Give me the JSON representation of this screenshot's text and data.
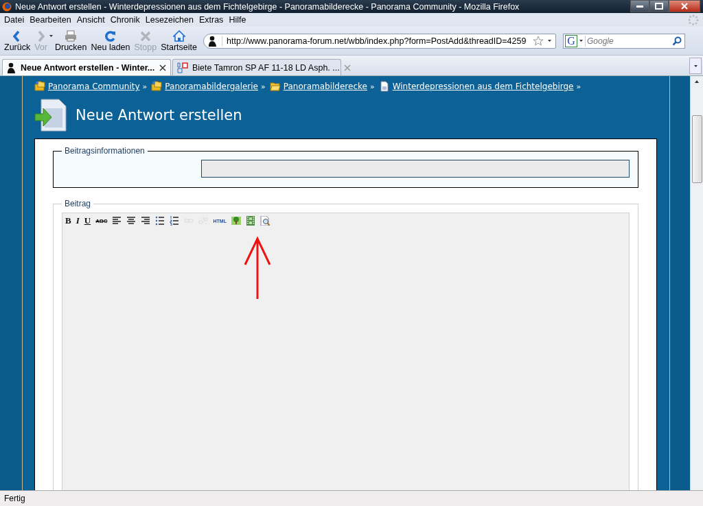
{
  "window": {
    "title": "Neue Antwort erstellen - Winterdepressionen aus dem Fichtelgebirge - Panoramabilderecke - Panorama Community - Mozilla Firefox"
  },
  "menu": [
    "Datei",
    "Bearbeiten",
    "Ansicht",
    "Chronik",
    "Lesezeichen",
    "Extras",
    "Hilfe"
  ],
  "nav_buttons": [
    {
      "kind": "back",
      "label": "Zurück",
      "disabled": false
    },
    {
      "kind": "forward",
      "label": "Vor",
      "disabled": true
    },
    {
      "kind": "print",
      "label": "Drucken",
      "disabled": false
    },
    {
      "kind": "reload",
      "label": "Neu laden",
      "disabled": false
    },
    {
      "kind": "stop",
      "label": "Stopp",
      "disabled": true
    },
    {
      "kind": "home",
      "label": "Startseite",
      "disabled": false
    }
  ],
  "address": {
    "value": "http://www.panorama-forum.net/wbb/index.php?form=PostAdd&threadID=4259"
  },
  "search": {
    "engine": "G",
    "placeholder": "Google"
  },
  "tabs": [
    {
      "label": "Neue Antwort erstellen - Winter...",
      "selected": true,
      "kind": "forum"
    },
    {
      "label": "Biete Tamron SP AF 11-18 LD Asph. ...",
      "selected": false,
      "kind": "dslr"
    }
  ],
  "breadcrumb": [
    {
      "label": "Panorama Community",
      "kind": "folders",
      "after": "»"
    },
    {
      "label": "Panoramabildergalerie",
      "kind": "folders",
      "after": "»"
    },
    {
      "label": "Panoramabilderecke",
      "kind": "folder",
      "after": "»"
    },
    {
      "label": "Winterdepressionen aus dem Fichtelgebirge",
      "kind": "page",
      "after": "»"
    }
  ],
  "heading": "Neue Antwort erstellen",
  "sections": [
    {
      "legend": "Beitragsinformationen",
      "kind": "info"
    },
    {
      "legend": "Beitrag",
      "kind": "editor"
    }
  ],
  "editor_toolbar": [
    {
      "kind": "bold",
      "label": "B",
      "disabled": false
    },
    {
      "kind": "italic",
      "label": "I",
      "disabled": false
    },
    {
      "kind": "underline",
      "label": "U",
      "disabled": false
    },
    {
      "kind": "strike",
      "label": "ABC",
      "disabled": false
    },
    {
      "kind": "align-left",
      "disabled": false
    },
    {
      "kind": "align-center",
      "disabled": false
    },
    {
      "kind": "align-right",
      "disabled": false
    },
    {
      "kind": "bullets",
      "disabled": false
    },
    {
      "kind": "numbers",
      "disabled": false
    },
    {
      "kind": "link",
      "disabled": true
    },
    {
      "kind": "unlink",
      "disabled": true
    },
    {
      "kind": "html",
      "label": "HTML",
      "disabled": false
    },
    {
      "kind": "image",
      "disabled": false
    },
    {
      "kind": "film",
      "disabled": false
    },
    {
      "kind": "preview",
      "disabled": false
    }
  ],
  "status_bar": {
    "text": "Fertig"
  }
}
